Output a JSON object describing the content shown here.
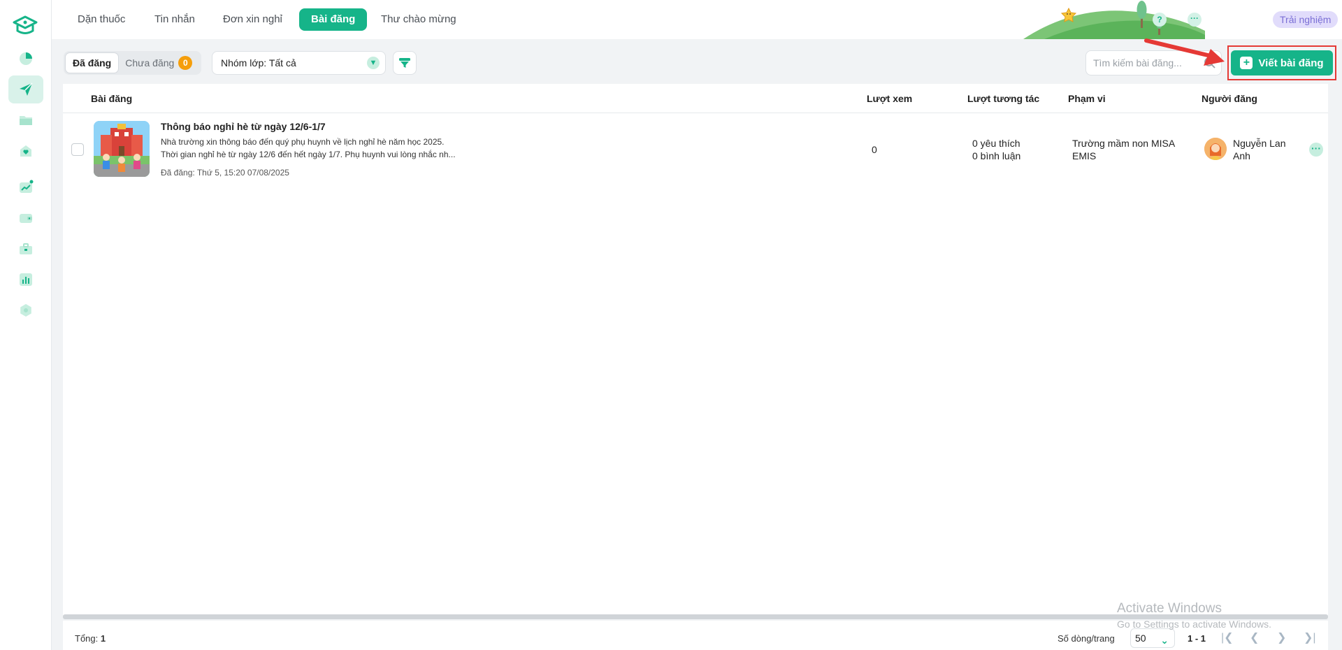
{
  "tabs": [
    {
      "label": "Dặn thuốc",
      "active": false
    },
    {
      "label": "Tin nhắn",
      "active": false
    },
    {
      "label": "Đơn xin nghỉ",
      "active": false
    },
    {
      "label": "Bài đăng",
      "active": true
    },
    {
      "label": "Thư chào mừng",
      "active": false
    }
  ],
  "header": {
    "help_label": "?",
    "more_label": "···",
    "trial_label": "Trải nghiệm"
  },
  "sidebar": {
    "items": [
      {
        "icon": "chart-pie-icon",
        "active": false
      },
      {
        "icon": "send-icon",
        "active": true
      },
      {
        "icon": "folder-icon",
        "active": false
      },
      {
        "icon": "health-icon",
        "active": false
      },
      {
        "icon": "trend-icon",
        "active": false
      },
      {
        "icon": "wallet-icon",
        "active": false
      },
      {
        "icon": "briefcase-icon",
        "active": false
      },
      {
        "icon": "bar-chart-icon",
        "active": false
      },
      {
        "icon": "settings-icon",
        "active": false
      }
    ]
  },
  "toolbar": {
    "published_label": "Đã đăng",
    "draft_label": "Chưa đăng",
    "draft_count": "0",
    "class_filter": "Nhóm lớp: Tất cả",
    "search_placeholder": "Tìm kiếm bài đăng...",
    "write_label": "Viết bài đăng"
  },
  "table": {
    "columns": {
      "post": "Bài đăng",
      "views": "Lượt xem",
      "interactions": "Lượt tương tác",
      "scope": "Phạm vi",
      "author": "Người đăng"
    },
    "rows": [
      {
        "title": "Thông báo nghỉ hè từ ngày 12/6-1/7",
        "line1": "Nhà trường xin thông báo đến quý phụ huynh về lịch nghỉ hè năm học 2025.",
        "line2": "Thời gian nghỉ hè từ ngày 12/6 đến hết ngày 1/7. Phụ huynh vui lòng nhắc nh...",
        "date": "Đã đăng: Thứ 5, 15:20 07/08/2025",
        "views": "0",
        "likes": "0 yêu thích",
        "comments": "0 bình luận",
        "scope_line1": "Trường mầm non MISA",
        "scope_line2": "EMIS",
        "author_line1": "Nguyễn Lan",
        "author_line2": "Anh"
      }
    ]
  },
  "footer": {
    "total_label": "Tổng:",
    "total_value": "1",
    "rows_label": "Số dòng/trang",
    "rows_value": "50",
    "range": "1 - 1"
  },
  "watermark": {
    "line1": "Activate Windows",
    "line2": "Go to Settings to activate Windows."
  },
  "colors": {
    "accent": "#16b489",
    "highlight": "#e53935",
    "badge": "#f59e0b"
  }
}
